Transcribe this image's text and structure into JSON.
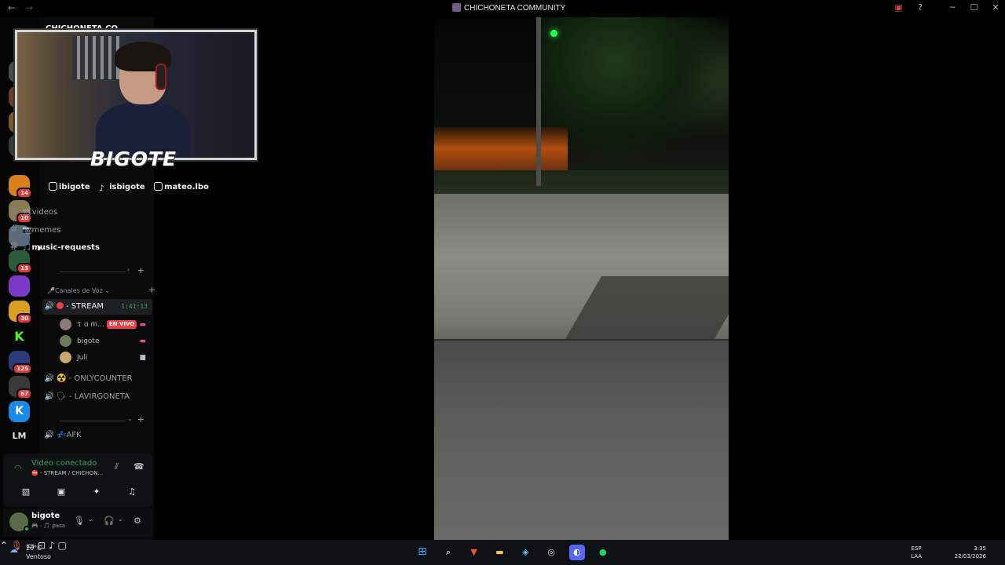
{
  "window": {
    "title": "CHICHONETA COMMUNITY",
    "nav_back": "←",
    "nav_forward": "→"
  },
  "server": {
    "name": "CHICHONETA CO..."
  },
  "rail": [
    {
      "name": "server-1",
      "badge": "",
      "color": "#3a3a3a"
    },
    {
      "name": "server-2",
      "badge": "",
      "color": "#5a3a2a"
    },
    {
      "name": "server-3",
      "badge": "",
      "color": "#6a5a20"
    },
    {
      "name": "server-4",
      "badge": "14",
      "color": "#d8801a"
    },
    {
      "name": "server-5",
      "badge": "10",
      "color": "#8a7a50"
    },
    {
      "name": "server-6",
      "badge": "",
      "color": "#5a6a7a"
    },
    {
      "name": "server-7",
      "badge": "13",
      "color": "#2a5a3a"
    },
    {
      "name": "server-8",
      "badge": "",
      "color": "#7a3ac8"
    },
    {
      "name": "server-9",
      "badge": "30",
      "color": "#d8a020"
    },
    {
      "name": "server-kick",
      "badge": "",
      "color": "#53fc18",
      "label": "K"
    },
    {
      "name": "server-10",
      "badge": "125",
      "color": "#2a3a7a"
    },
    {
      "name": "server-11",
      "badge": "67",
      "color": "#3a3a3a"
    },
    {
      "name": "server-kiko",
      "badge": "",
      "color": "#1a8ae8",
      "label": "K"
    },
    {
      "name": "server-lm",
      "badge": "",
      "color": "transparent",
      "label": "LM"
    }
  ],
  "overlay": {
    "streamer": "BIGOTE",
    "twitch": "ibigote",
    "tiktok": "isbigote",
    "instagram": "mateo.lbo"
  },
  "text_channels": [
    {
      "label": "📽videos",
      "active": false
    },
    {
      "label": "📷memes",
      "active": false
    },
    {
      "label": "🎵music-requests",
      "active": true
    }
  ],
  "voice_category": {
    "label": "🎤Canales de Voz ⌄"
  },
  "voice_channels": {
    "stream": {
      "label": "- STREAM",
      "timer": "1:41:13"
    },
    "members": [
      {
        "name": "𝔗 ɑ m...",
        "live": "EN VIVO",
        "color": "#8a7a7a"
      },
      {
        "name": "bigote",
        "live": "",
        "color": "#6a7a5a"
      },
      {
        "name": "Juli",
        "live": "",
        "color": "#c8a870"
      }
    ],
    "onlycounter": "☢️ - ONLYCOUNTER",
    "lavirgoneta": "🗣 - LAVIRGONETA",
    "afk": "💤AFK"
  },
  "voice_panel": {
    "status": "Video conectado",
    "channel": "⛔ - STREAM / CHICHON..."
  },
  "user": {
    "name": "bigote",
    "status": "🎮 · 🎵 pasa"
  },
  "taskbar": {
    "temp": "20°C",
    "weather": "Ventoso",
    "lang1": "ESP",
    "lang2": "LAA",
    "time": "3:35",
    "date": "22/03/2026"
  }
}
